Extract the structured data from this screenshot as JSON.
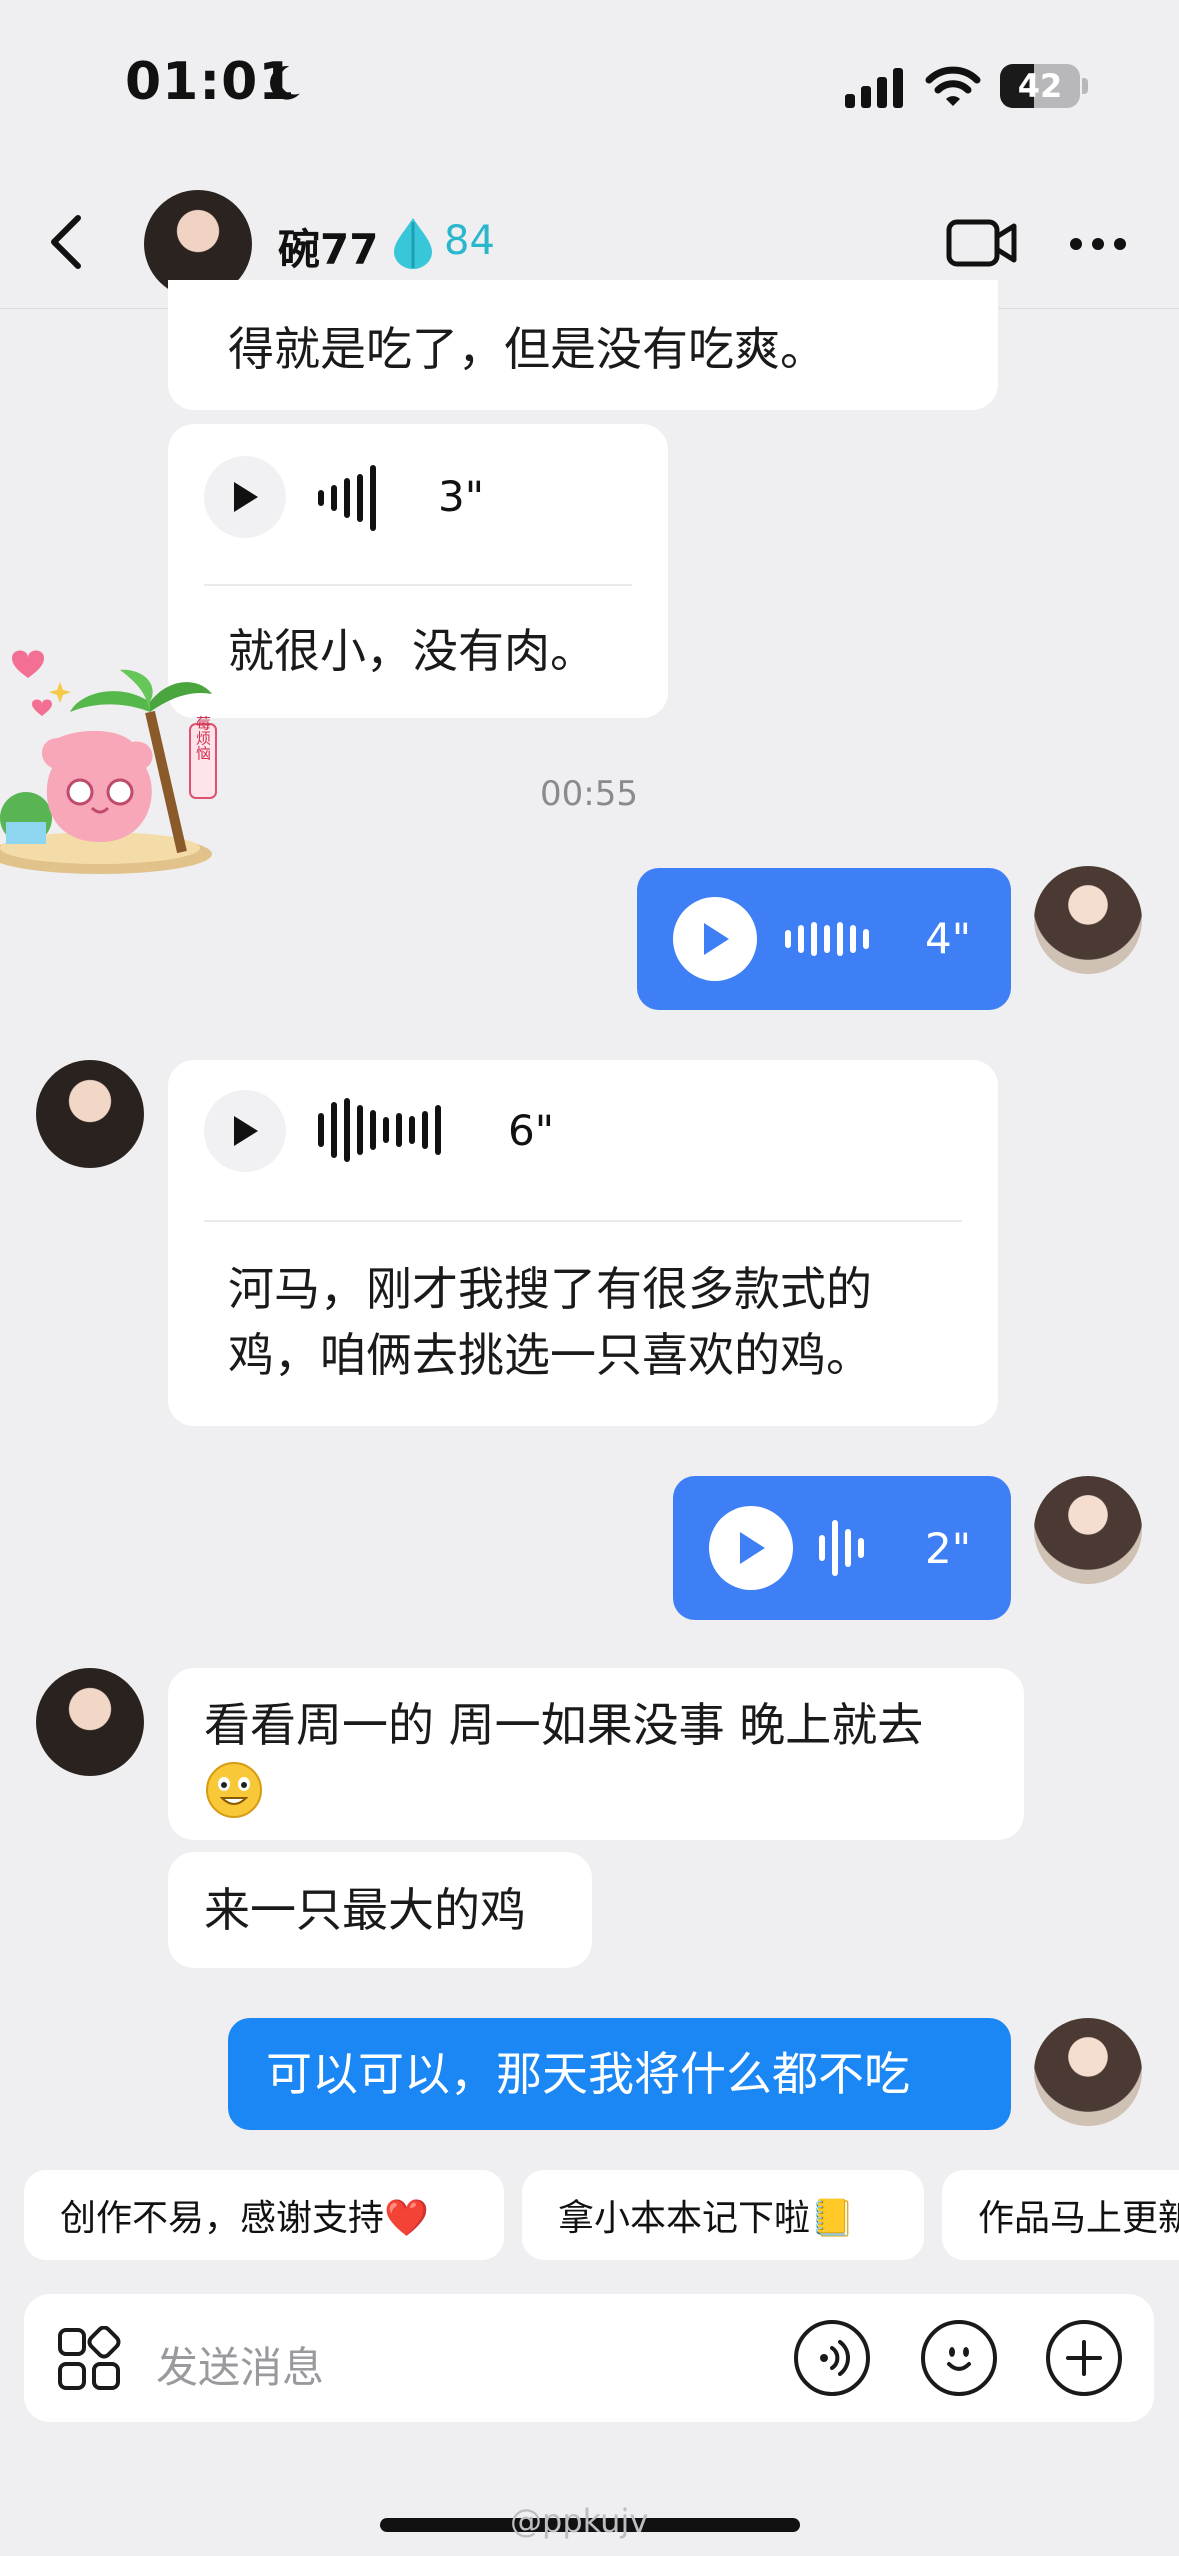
{
  "status_bar": {
    "time": "01:01",
    "battery": "42",
    "battery_level": 0.42
  },
  "header": {
    "name": "碗77",
    "score": "84"
  },
  "colors": {
    "outgoing_voice": "#3e7ff6",
    "outgoing_text": "#1a87f5",
    "incoming": "#ffffff",
    "background": "#efeff1",
    "score": "#2ab6cc"
  },
  "messages": {
    "m1_text": "得就是吃了，但是没有吃爽。",
    "m2_voice": "3\"",
    "m2_text": "就很小，没有肉。",
    "sticker_tag": "莓烦恼",
    "timestamp": "00:55",
    "m3_voice": "4\"",
    "m4_voice": "6\"",
    "m4_text_line1": "河马，刚才我搜了有很多款式的",
    "m4_text_line2": "鸡，咱俩去挑选一只喜欢的鸡。",
    "m5_voice": "2\"",
    "m6_text": "看看周一的 周一如果没事 晚上就去",
    "m7_text": "来一只最大的鸡",
    "m8_text": "可以可以，那天我将什么都不吃"
  },
  "quick_replies": [
    "创作不易，感谢支持❤️",
    "拿小本本记下啦📒",
    "作品马上更新"
  ],
  "input": {
    "placeholder": "发送消息"
  },
  "watermark": "@ppkujv",
  "icons": [
    "moon-icon",
    "signal-icon",
    "wifi-icon",
    "back-icon",
    "water-drop-icon",
    "video-call-icon",
    "more-icon",
    "play-icon",
    "waveform-icon",
    "apps-icon",
    "voice-input-icon",
    "emoji-icon",
    "add-icon",
    "emoji-grin-icon"
  ]
}
